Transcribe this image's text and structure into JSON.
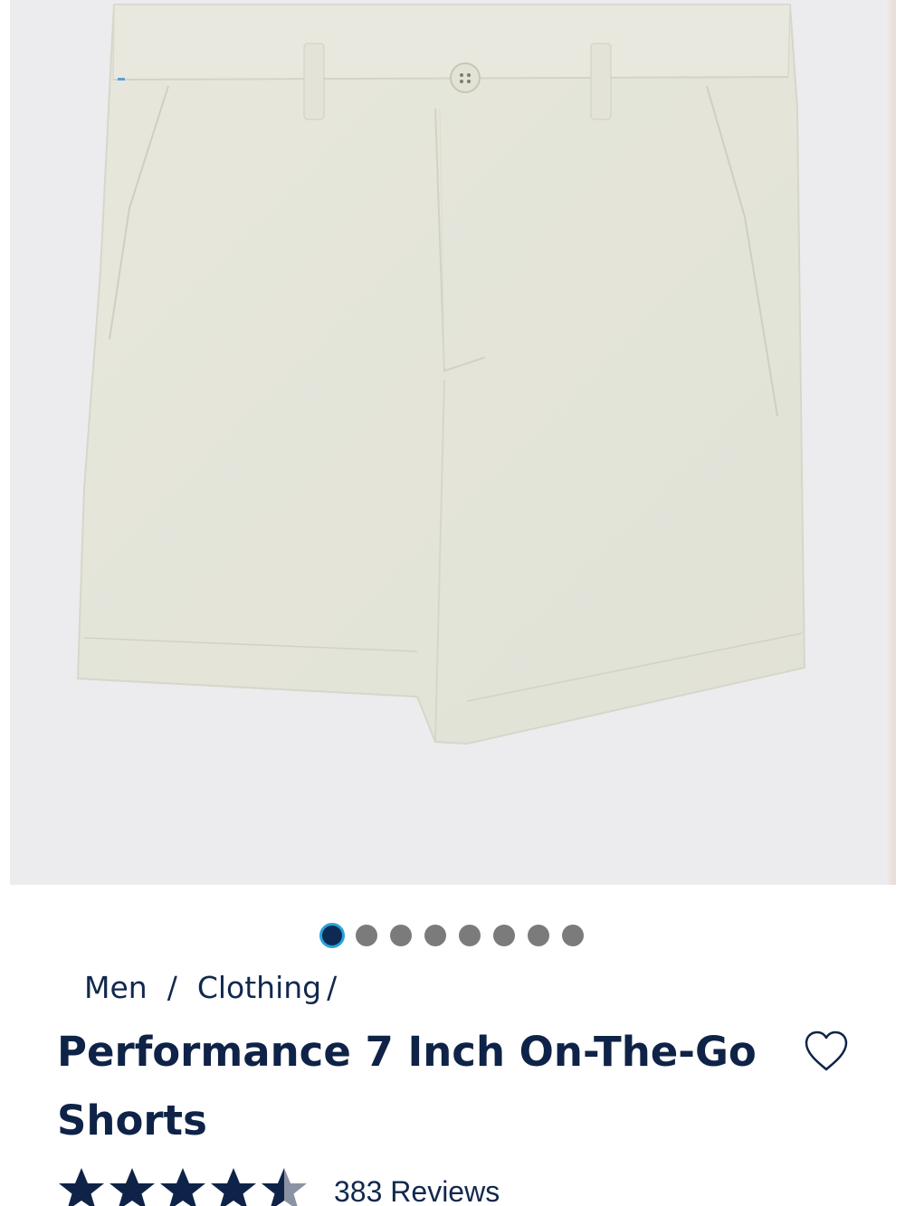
{
  "product_image": {
    "alt": "Performance 7 Inch On-The-Go Shorts",
    "background_color": "#ececee",
    "garment_color": "#e6e6da"
  },
  "carousel": {
    "total": 8,
    "active_index": 0,
    "active_color": "#0c2a54",
    "inactive_color": "#7b7b7b"
  },
  "breadcrumb": {
    "items": [
      "Men",
      "Clothing"
    ],
    "separator": "/"
  },
  "product": {
    "title": "Performance 7 Inch On-The-Go Shorts",
    "rating": 4.5,
    "rating_max": 5,
    "reviews_label": "383 Reviews"
  },
  "colors": {
    "navy": "#0e2347",
    "accent": "#2aa3d8"
  },
  "icons": {
    "favorite": "heart-outline-icon",
    "star": "star-icon"
  }
}
